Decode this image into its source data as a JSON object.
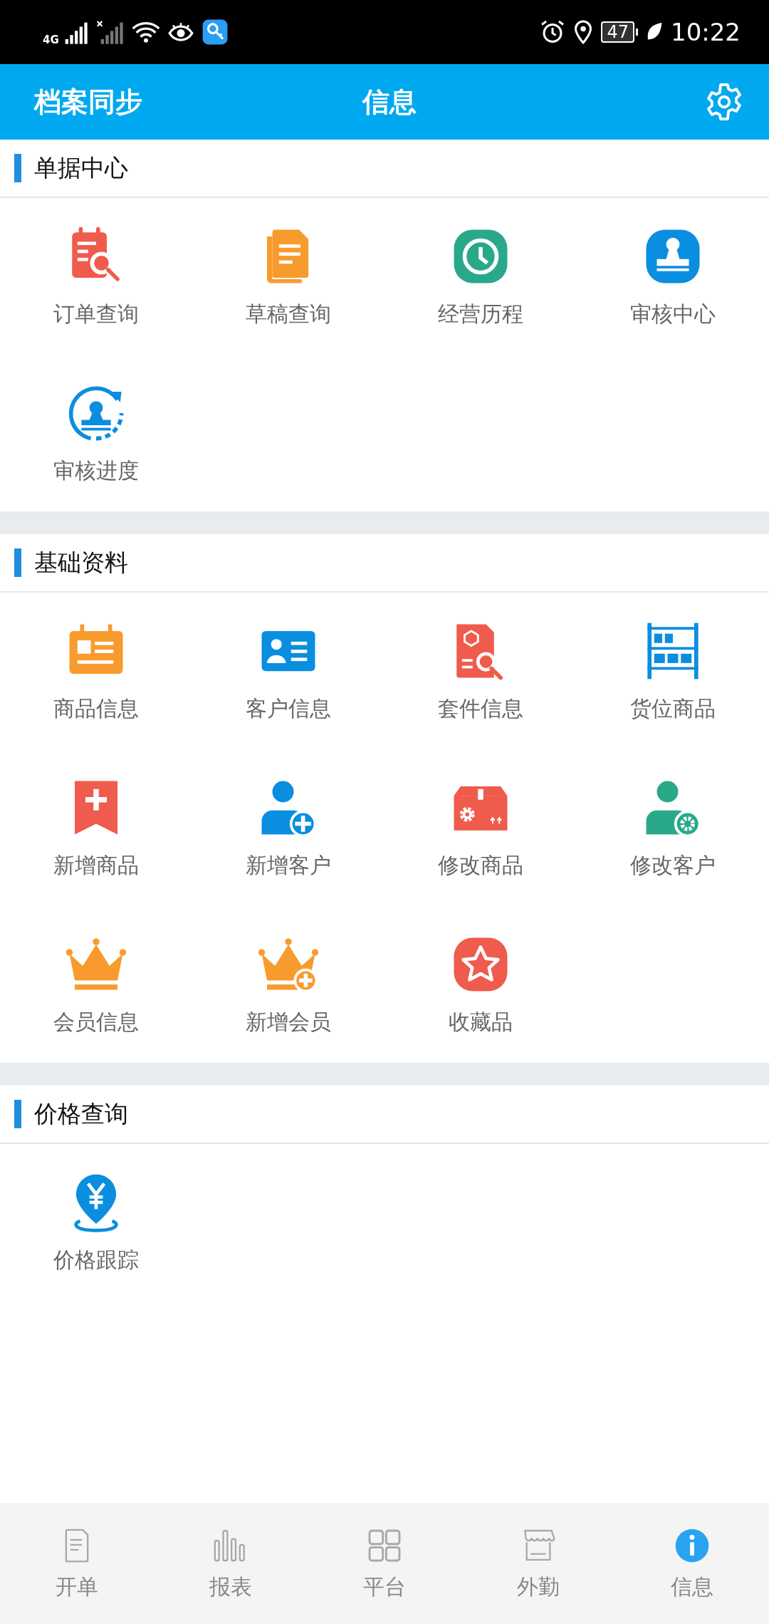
{
  "status_bar": {
    "network": "4G",
    "battery": "47",
    "time": "10:22"
  },
  "header": {
    "left": "档案同步",
    "title": "信息"
  },
  "sections": [
    {
      "title": "单据中心",
      "items": [
        "订单查询",
        "草稿查询",
        "经营历程",
        "审核中心",
        "审核进度"
      ]
    },
    {
      "title": "基础资料",
      "items": [
        "商品信息",
        "客户信息",
        "套件信息",
        "货位商品",
        "新增商品",
        "新增客户",
        "修改商品",
        "修改客户",
        "会员信息",
        "新增会员",
        "收藏品"
      ]
    },
    {
      "title": "价格查询",
      "items": [
        "价格跟踪"
      ]
    }
  ],
  "nav": [
    {
      "label": "开单",
      "selected": false
    },
    {
      "label": "报表",
      "selected": false
    },
    {
      "label": "平台",
      "selected": false
    },
    {
      "label": "外勤",
      "selected": false
    },
    {
      "label": "信息",
      "selected": true
    }
  ]
}
